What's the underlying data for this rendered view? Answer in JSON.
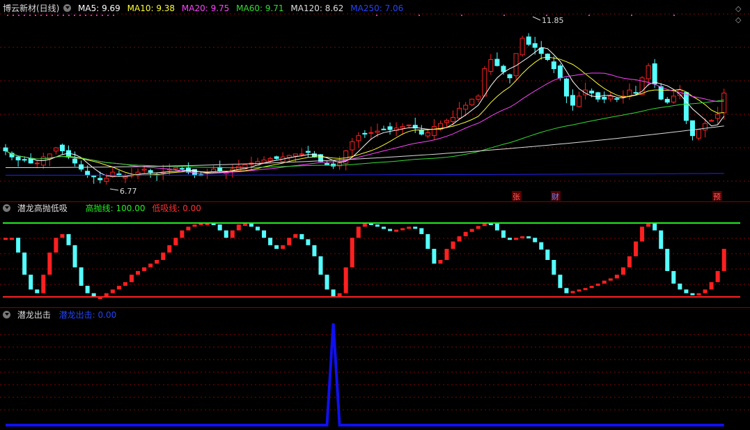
{
  "main_header": {
    "title": "博云新材(日线)",
    "ma5": "MA5: 9.69",
    "ma10": "MA10: 9.38",
    "ma20": "MA20: 9.75",
    "ma60": "MA60: 9.71",
    "ma120": "MA120: 8.62",
    "ma250": "MA250: 7.06"
  },
  "colors": {
    "up": "#ff2020",
    "down": "#55ffff",
    "ma5": "#ffffff",
    "ma10": "#ffff33",
    "ma20": "#ff44ff",
    "ma60": "#33dd33",
    "ma120": "#dddddd",
    "ma250": "#2222ff",
    "grid": "#8b0000",
    "high_line": "#22ee22",
    "low_line": "#ff2020",
    "signal": "#1010ee"
  },
  "markers": {
    "high_price": "11.85",
    "low_price": "6.77",
    "events": [
      "张",
      "财",
      "预"
    ]
  },
  "indicator1": {
    "title": "潜龙高抛低吸",
    "high_label": "高抛线: 100.00",
    "low_label": "低吸线: 0.00"
  },
  "indicator2": {
    "title": "潜龙出击",
    "label": "潜龙出击: 0.00"
  },
  "chart_data": [
    {
      "type": "candlestick",
      "price_range": [
        6.3,
        12.3
      ],
      "series": [
        {
          "name": "MA5"
        },
        {
          "name": "MA10"
        },
        {
          "name": "MA20"
        },
        {
          "name": "MA60"
        },
        {
          "name": "MA120"
        },
        {
          "name": "MA250"
        }
      ],
      "close": [
        7.8,
        7.6,
        7.5,
        7.5,
        7.4,
        7.4,
        7.6,
        7.7,
        7.9,
        7.8,
        7.6,
        7.4,
        7.2,
        7.0,
        6.95,
        6.85,
        6.9,
        7.1,
        7.0,
        6.95,
        7.0,
        7.1,
        7.2,
        7.1,
        7.0,
        7.1,
        7.2,
        7.25,
        7.2,
        7.1,
        7.0,
        7.0,
        7.1,
        7.2,
        7.15,
        7.1,
        7.2,
        7.3,
        7.35,
        7.4,
        7.45,
        7.5,
        7.55,
        7.55,
        7.6,
        7.65,
        7.7,
        7.7,
        7.75,
        7.6,
        7.45,
        7.35,
        7.3,
        7.4,
        7.8,
        8.1,
        8.3,
        8.35,
        8.4,
        8.45,
        8.5,
        8.5,
        8.55,
        8.6,
        8.65,
        8.55,
        8.35,
        8.4,
        8.6,
        8.7,
        8.8,
        8.9,
        9.2,
        9.3,
        9.5,
        9.6,
        10.5,
        10.8,
        10.6,
        10.4,
        10.2,
        11.0,
        11.5,
        11.3,
        11.2,
        11.0,
        10.8,
        10.5,
        10.2,
        9.6,
        9.3,
        9.6,
        9.8,
        9.7,
        9.5,
        9.5,
        9.6,
        9.5,
        9.6,
        9.8,
        9.7,
        10.2,
        10.6,
        10.0,
        9.5,
        9.4,
        9.6,
        9.8,
        8.8,
        8.3,
        8.5,
        8.7,
        8.8,
        9.0,
        9.7
      ],
      "ma_last": {
        "MA5": 9.69,
        "MA10": 9.38,
        "MA20": 9.75,
        "MA60": 9.71,
        "MA120": 8.62,
        "MA250": 7.06
      }
    },
    {
      "type": "bar",
      "title": "潜龙高抛低吸",
      "ylim": [
        0,
        100
      ],
      "reference_lines": {
        "高抛线": 100,
        "低吸线": 0
      },
      "values": [
        80,
        80,
        60,
        30,
        10,
        5,
        30,
        60,
        80,
        85,
        70,
        40,
        15,
        5,
        0,
        0,
        5,
        10,
        15,
        20,
        30,
        35,
        40,
        45,
        50,
        60,
        70,
        80,
        90,
        95,
        98,
        100,
        100,
        98,
        90,
        80,
        90,
        98,
        99,
        95,
        90,
        80,
        70,
        65,
        70,
        80,
        85,
        78,
        70,
        55,
        30,
        10,
        0,
        5,
        40,
        80,
        95,
        100,
        98,
        95,
        92,
        90,
        91,
        93,
        95,
        93,
        85,
        65,
        45,
        50,
        65,
        75,
        82,
        88,
        92,
        96,
        100,
        99,
        90,
        80,
        78,
        80,
        82,
        80,
        74,
        64,
        50,
        30,
        12,
        5,
        8,
        10,
        12,
        15,
        18,
        22,
        25,
        30,
        40,
        55,
        75,
        95,
        100,
        90,
        65,
        35,
        18,
        10,
        5,
        4,
        5,
        10,
        20,
        35,
        65
      ]
    },
    {
      "type": "line",
      "title": "潜龙出击",
      "ylim": [
        0,
        1
      ],
      "values_note_index": 52,
      "values": [
        0,
        0,
        0,
        0,
        0,
        0,
        0,
        0,
        0,
        0,
        0,
        0,
        0,
        0,
        0,
        0,
        0,
        0,
        0,
        0,
        0,
        0,
        0,
        0,
        0,
        0,
        0,
        0,
        0,
        0,
        0,
        0,
        0,
        0,
        0,
        0,
        0,
        0,
        0,
        0,
        0,
        0,
        0,
        0,
        0,
        0,
        0,
        0,
        0,
        0,
        0,
        0,
        1,
        0,
        0,
        0,
        0,
        0,
        0,
        0,
        0,
        0,
        0,
        0,
        0,
        0,
        0,
        0,
        0,
        0,
        0,
        0,
        0,
        0,
        0,
        0,
        0,
        0,
        0,
        0,
        0,
        0,
        0,
        0,
        0,
        0,
        0,
        0,
        0,
        0,
        0,
        0,
        0,
        0,
        0,
        0,
        0,
        0,
        0,
        0,
        0,
        0,
        0,
        0,
        0,
        0,
        0,
        0,
        0,
        0,
        0,
        0,
        0,
        0,
        0
      ]
    }
  ]
}
